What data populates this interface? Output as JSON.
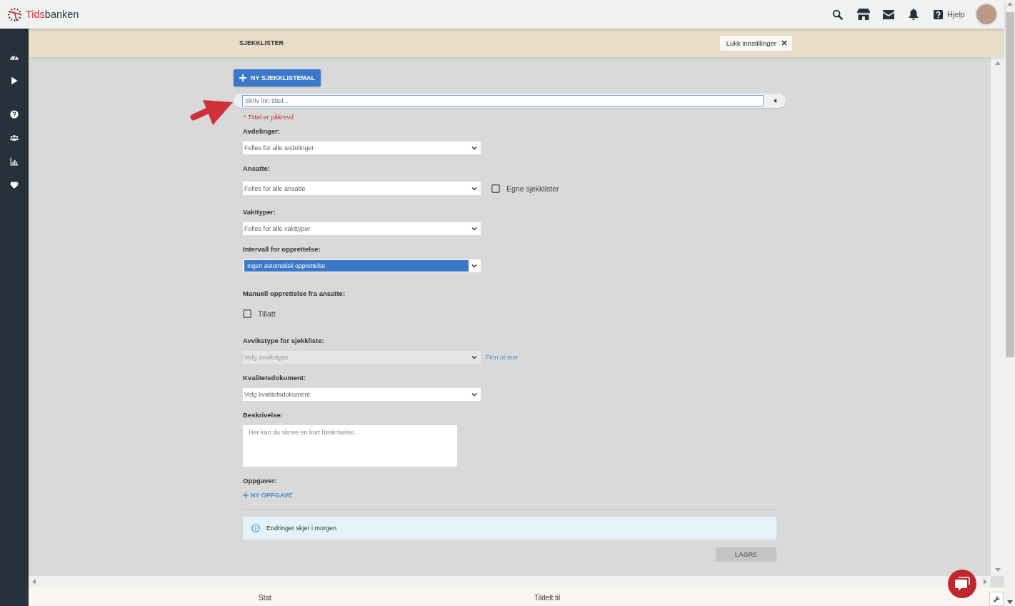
{
  "top_bar": {
    "logo": {
      "accent": "Tids",
      "rest": "banken"
    },
    "help_label": "Hjelp"
  },
  "header": {
    "title": "SJEKKLISTER",
    "close_button": "Lukk innstillinger"
  },
  "form": {
    "new_template_button": "NY SJEKKLISTEMAL",
    "title_field": {
      "placeholder": "Skriv inn tittel...",
      "focused": true
    },
    "title_error": "* Tittel er påkrevd",
    "fields": [
      {
        "kind": "select",
        "label": "Avdelinger:",
        "value": "Felles for alle avdelinger",
        "highlighted": false,
        "disabled": false
      },
      {
        "kind": "select",
        "label": "Ansatte:",
        "value": "Felles for alle ansatte",
        "highlighted": false,
        "disabled": false,
        "checkbox": {
          "label": "Egne sjekklister",
          "checked": false
        }
      },
      {
        "kind": "select",
        "label": "Vakttyper:",
        "value": "Felles for alle vakttyper",
        "highlighted": false,
        "disabled": false
      },
      {
        "kind": "select",
        "label": "Intervall for opprettelse:",
        "value": "Ingen automatisk opprettelse",
        "highlighted": true,
        "disabled": false
      },
      {
        "kind": "checkbox",
        "label": "Manuell opprettelse fra ansatte:",
        "option": {
          "label": "Tillatt",
          "checked": false
        }
      },
      {
        "kind": "select",
        "label": "Avvikstype for sjekkliste:",
        "value": "Velg avvikstype",
        "highlighted": false,
        "disabled": true,
        "link": "Finn ut mer"
      },
      {
        "kind": "select",
        "label": "Kvalitetsdokument:",
        "value": "Velg kvalitetsdokument",
        "highlighted": false,
        "disabled": false
      },
      {
        "kind": "textarea",
        "label": "Beskrivelse:",
        "placeholder": "Her kan du skrive en kort beskrivelse..."
      },
      {
        "kind": "tasks",
        "label": "Oppgaver:",
        "add_link": "NY OPPGAVE"
      }
    ],
    "info": "Endringer skjer i morgen",
    "save_button": {
      "label": "LAGRE",
      "disabled": true
    }
  },
  "footer": {
    "columns": [
      "Stat",
      "Tildelt til"
    ]
  }
}
